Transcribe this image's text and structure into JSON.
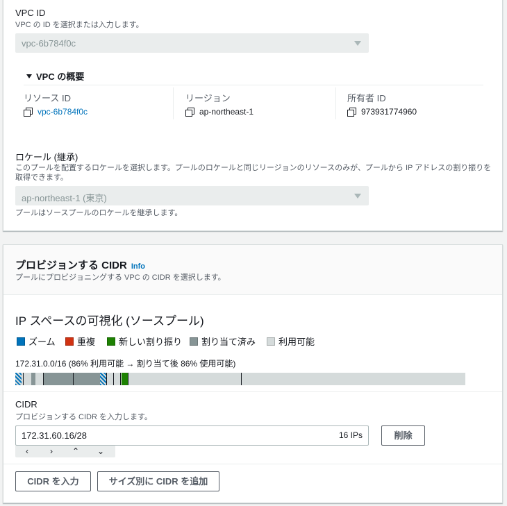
{
  "vpc": {
    "label": "VPC ID",
    "description": "VPC の ID を選択または入力します。",
    "selected": "vpc-6b784f0c",
    "overview": {
      "title": "VPC の概要",
      "resource_id_label": "リソース ID",
      "resource_id": "vpc-6b784f0c",
      "region_label": "リージョン",
      "region": "ap-northeast-1",
      "owner_label": "所有者 ID",
      "owner": "973931774960"
    }
  },
  "locale": {
    "label": "ロケール (継承)",
    "description": "このプールを配置するロケールを選択します。プールのロケールと同じリージョンのリソースのみが、プールから IP アドレスの割り振りを取得できます。",
    "selected": "ap-northeast-1 (東京)",
    "hint": "プールはソースプールのロケールを継承します。"
  },
  "provision": {
    "title": "プロビジョンする CIDR",
    "info": "Info",
    "description": "プールにプロビジョニングする VPC の CIDR を選択します。",
    "visual_title": "IP スペースの可視化 (ソースプール)",
    "legend": [
      {
        "label": "ズーム",
        "color": "#0073bb"
      },
      {
        "label": "重複",
        "color": "#d13212"
      },
      {
        "label": "新しい割り振り",
        "color": "#1d8102"
      },
      {
        "label": "割り当て済み",
        "color": "#879596"
      },
      {
        "label": "利用可能",
        "color": "#d5dbdb"
      }
    ],
    "summary": "172.31.0.0/16 (86% 利用可能 → 割り当て後 86% 使用可能)",
    "cidr_label": "CIDR",
    "cidr_description": "プロビジョンする CIDR を入力します。",
    "cidr_value": "172.31.60.16/28",
    "cidr_count": "16 IPs",
    "delete_button": "削除",
    "stepper": {
      "prev": "‹",
      "next": "›",
      "up": "⌃",
      "down": "⌄"
    },
    "enter_cidr_button": "CIDR を入力",
    "add_by_size_button": "サイズ別に CIDR を追加"
  }
}
